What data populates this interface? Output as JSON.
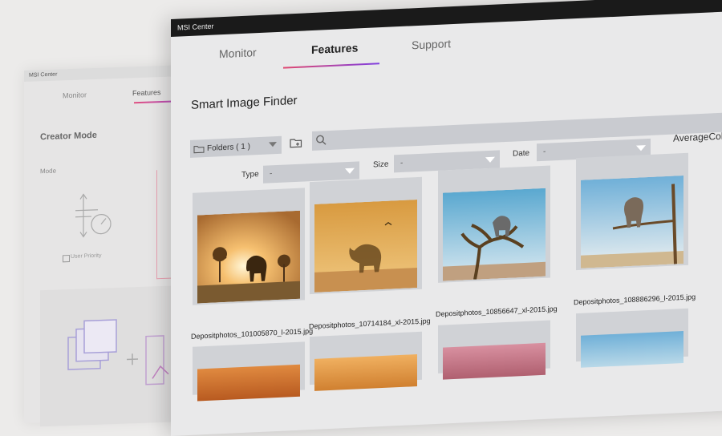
{
  "back_window": {
    "title": "MSI Center",
    "tabs": [
      {
        "label": "Monitor"
      },
      {
        "label": "Features"
      }
    ],
    "heading": "Creator Mode",
    "mode_label": "Mode",
    "user_priority_label": "User Priority"
  },
  "window": {
    "title": "MSI Center",
    "tabs": [
      {
        "label": "Monitor"
      },
      {
        "label": "Features"
      },
      {
        "label": "Support"
      }
    ],
    "page_title": "Smart Image Finder",
    "folder_select_label": "Folders ( 1 )",
    "filters": {
      "type_label": "Type",
      "type_value": "-",
      "size_label": "Size",
      "size_value": "-",
      "date_label": "Date",
      "date_value": "-",
      "average_color_label": "AverageColo"
    },
    "images": [
      {
        "filename": "Depositphotos_101005870_l-2015.jpg"
      },
      {
        "filename": "Depositphotos_10714184_xl-2015.jpg"
      },
      {
        "filename": "Depositphotos_10856647_xl-2015.jpg"
      },
      {
        "filename": "Depositphotos_108886296_l-2015.jpg"
      }
    ]
  },
  "colors": {
    "accent_start": "#e04870",
    "accent_end": "#8040e0",
    "titlebar": "#1a1a1a"
  }
}
